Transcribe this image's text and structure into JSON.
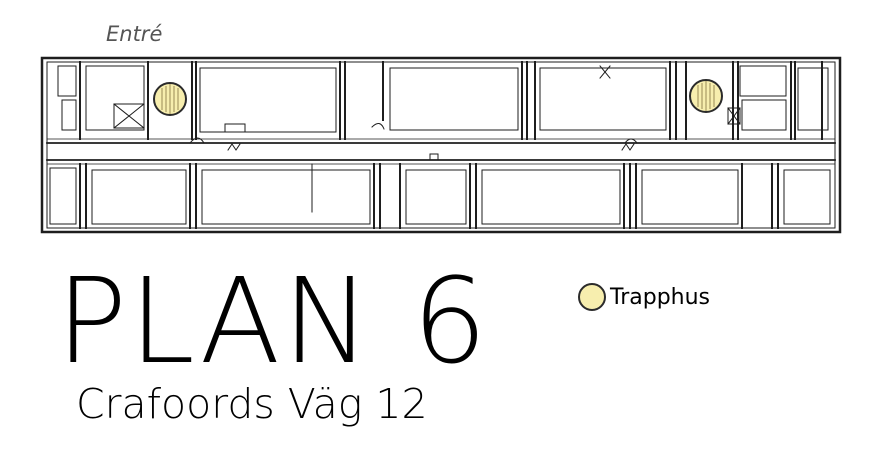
{
  "map": {
    "entrance_label": "Entré",
    "title": "PLAN 6",
    "address": "Crafoords Väg 12",
    "legend": [
      {
        "label": "Trapphus",
        "fill": "#f7eeae",
        "stroke": "#2b2b2b",
        "icon": "stairwell-circle-icon"
      }
    ],
    "colors": {
      "wall": "#1e1e1e",
      "stairwell": "#f7eeae",
      "background": "#ffffff"
    }
  }
}
